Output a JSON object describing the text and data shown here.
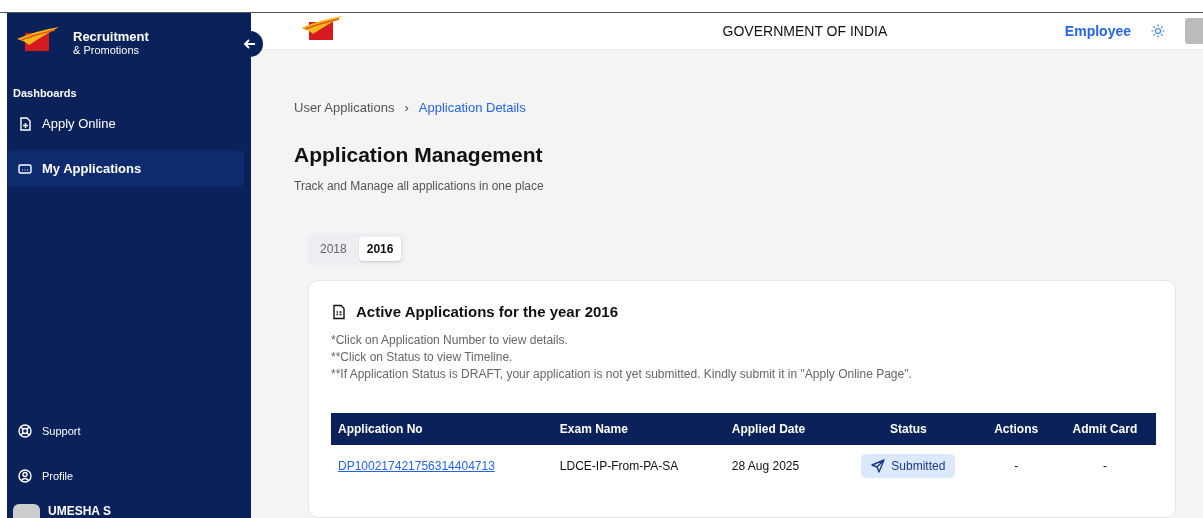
{
  "sidebar": {
    "brand_title": "Recruitment",
    "brand_subtitle": "& Promotions",
    "section": "Dashboards",
    "items": [
      {
        "label": "Apply Online",
        "kind": "apply",
        "selected": false
      },
      {
        "label": "My Applications",
        "kind": "applications",
        "selected": true
      }
    ],
    "bottom_items": [
      {
        "label": "Support",
        "kind": "support"
      },
      {
        "label": "Profile",
        "kind": "profile"
      }
    ],
    "user_name": "UMESHA S"
  },
  "header": {
    "title": "GOVERNMENT OF INDIA",
    "role": "Employee"
  },
  "breadcrumb": {
    "separator": "›",
    "items": [
      {
        "label": "User Applications",
        "current": false
      },
      {
        "label": "Application Details",
        "current": true
      }
    ]
  },
  "page": {
    "title": "Application Management",
    "subtitle": "Track and Manage all applications in one place"
  },
  "year_tabs": [
    {
      "label": "2018",
      "selected": false
    },
    {
      "label": "2016",
      "selected": true
    }
  ],
  "card": {
    "title": "Active Applications for the year 2016",
    "notes": [
      "*Click on Application Number to view details.",
      "**Click on Status to view Timeline.",
      "**If Application Status is DRAFT, your application is not yet submitted. Kindly submit it in \"Apply Online Page\"."
    ],
    "table": {
      "columns": [
        "Application No",
        "Exam Name",
        "Applied Date",
        "Status",
        "Actions",
        "Admit Card"
      ],
      "rows": [
        {
          "application_no": "DP100217421756314404713",
          "exam_name": "LDCE-IP-From-PA-SA",
          "applied_date": "28 Aug 2025",
          "status": "Submitted",
          "actions": "-",
          "admit_card": "-"
        }
      ]
    }
  }
}
